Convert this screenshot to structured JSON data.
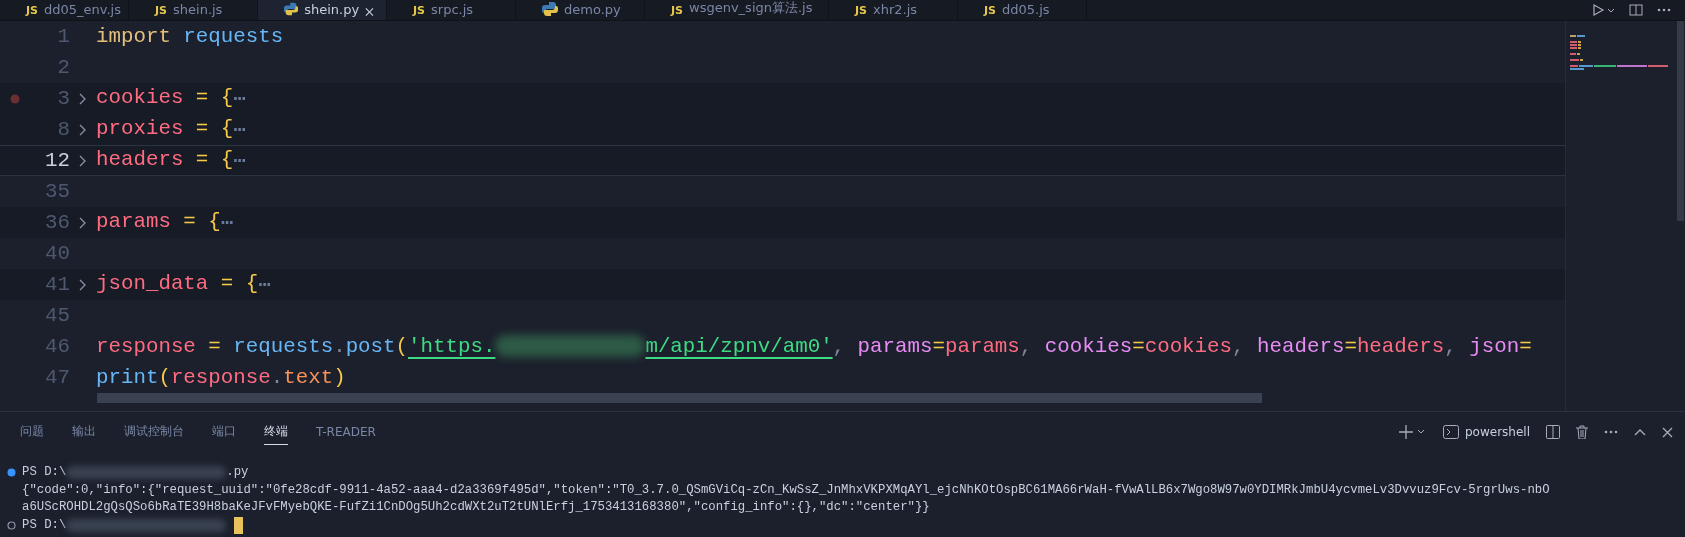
{
  "editor_tabs": [
    {
      "label": "dd05_env.js",
      "badge": "JS",
      "kind": "js",
      "selected": false
    },
    {
      "label": "shein.js",
      "badge": "JS",
      "kind": "js",
      "selected": false
    },
    {
      "label": "shein.py",
      "kind": "py",
      "selected": true
    },
    {
      "label": "srpc.js",
      "badge": "JS",
      "kind": "js",
      "selected": false
    },
    {
      "label": "demo.py",
      "kind": "py",
      "selected": false
    },
    {
      "label": "wsgenv_sign算法.js",
      "badge": "JS",
      "kind": "js",
      "selected": false
    },
    {
      "label": "xhr2.js",
      "badge": "JS",
      "kind": "js",
      "selected": false
    },
    {
      "label": "dd05.js",
      "badge": "JS",
      "kind": "js",
      "selected": false
    }
  ],
  "code_lines": [
    {
      "number": "1",
      "folded": false,
      "breakpoint": false,
      "current": false,
      "tokens": [
        {
          "text": "import",
          "kind": "keyword"
        },
        {
          "text": " requests",
          "kind": "module"
        }
      ]
    },
    {
      "number": "2",
      "folded": false,
      "breakpoint": false,
      "current": false
    },
    {
      "number": "3",
      "folded": true,
      "breakpoint": true,
      "current": false,
      "tokens": [
        {
          "text": "cookies",
          "kind": "var"
        },
        {
          "text": " = ",
          "kind": "op"
        },
        {
          "text": "{",
          "kind": "brace"
        },
        {
          "text": "⋯",
          "kind": "fold"
        }
      ]
    },
    {
      "number": "8",
      "folded": true,
      "breakpoint": false,
      "current": false,
      "tokens": [
        {
          "text": "proxies",
          "kind": "var"
        },
        {
          "text": " = ",
          "kind": "op"
        },
        {
          "text": "{",
          "kind": "brace"
        },
        {
          "text": "⋯",
          "kind": "fold"
        }
      ]
    },
    {
      "number": "12",
      "folded": true,
      "breakpoint": false,
      "current": true,
      "tokens": [
        {
          "text": "headers",
          "kind": "var"
        },
        {
          "text": " = ",
          "kind": "op"
        },
        {
          "text": "{",
          "kind": "brace"
        },
        {
          "text": "⋯",
          "kind": "fold"
        }
      ]
    },
    {
      "number": "35",
      "folded": false,
      "breakpoint": false,
      "current": false
    },
    {
      "number": "36",
      "folded": true,
      "breakpoint": false,
      "current": false,
      "tokens": [
        {
          "text": "params",
          "kind": "var"
        },
        {
          "text": " = ",
          "kind": "op"
        },
        {
          "text": "{",
          "kind": "brace"
        },
        {
          "text": "⋯",
          "kind": "fold"
        }
      ]
    },
    {
      "number": "40",
      "folded": false,
      "breakpoint": false,
      "current": false
    },
    {
      "number": "41",
      "folded": true,
      "breakpoint": false,
      "current": false,
      "tokens": [
        {
          "text": "json_data",
          "kind": "var"
        },
        {
          "text": " = ",
          "kind": "op"
        },
        {
          "text": "{",
          "kind": "brace"
        },
        {
          "text": "⋯",
          "kind": "fold"
        }
      ]
    },
    {
      "number": "45",
      "folded": false,
      "breakpoint": false,
      "current": false
    },
    {
      "number": "46",
      "folded": false,
      "breakpoint": false,
      "current": false,
      "tokens": [
        {
          "text": "response",
          "kind": "var"
        },
        {
          "text": " = ",
          "kind": "op"
        },
        {
          "text": "requests",
          "kind": "module"
        },
        {
          "text": ".",
          "kind": "punct"
        },
        {
          "text": "post",
          "kind": "func"
        },
        {
          "text": "(",
          "kind": "brace"
        },
        {
          "text": "'https.",
          "kind": "string"
        },
        {
          "kind": "blur"
        },
        {
          "text": "m/api/zpnv/am0'",
          "kind": "string"
        },
        {
          "text": ", ",
          "kind": "punct"
        },
        {
          "text": "params",
          "kind": "param"
        },
        {
          "text": "=",
          "kind": "op"
        },
        {
          "text": "params",
          "kind": "var"
        },
        {
          "text": ", ",
          "kind": "punct"
        },
        {
          "text": "cookies",
          "kind": "param"
        },
        {
          "text": "=",
          "kind": "op"
        },
        {
          "text": "cookies",
          "kind": "var"
        },
        {
          "text": ", ",
          "kind": "punct"
        },
        {
          "text": "headers",
          "kind": "param"
        },
        {
          "text": "=",
          "kind": "op"
        },
        {
          "text": "headers",
          "kind": "var"
        },
        {
          "text": ", ",
          "kind": "punct"
        },
        {
          "text": "json",
          "kind": "param"
        },
        {
          "text": "=",
          "kind": "op"
        }
      ]
    },
    {
      "number": "47",
      "folded": false,
      "breakpoint": false,
      "current": false,
      "tokens": [
        {
          "text": "print",
          "kind": "func"
        },
        {
          "text": "(",
          "kind": "brace"
        },
        {
          "text": "response",
          "kind": "var"
        },
        {
          "text": ".",
          "kind": "punct"
        },
        {
          "text": "text",
          "kind": "attr"
        },
        {
          "text": ")",
          "kind": "brace"
        }
      ]
    }
  ],
  "panel_tabs": [
    {
      "label": "问题",
      "selected": false
    },
    {
      "label": "输出",
      "selected": false
    },
    {
      "label": "调试控制台",
      "selected": false
    },
    {
      "label": "端口",
      "selected": false
    },
    {
      "label": "终端",
      "selected": true
    },
    {
      "label": "T-READER",
      "selected": false
    }
  ],
  "terminal_shell": "powershell",
  "terminal_lines": [
    {
      "kind": "prompt",
      "succeeded": true,
      "prompt": "PS D:\\",
      "tail": ".py"
    },
    {
      "kind": "output",
      "text": "{\"code\":0,\"info\":{\"request_uuid\":\"0fe28cdf-9911-4a52-aaa4-d2a3369f495d\",\"token\":\"T0_3.7.0_QSmGViCq-zCn_KwSsZ_JnMhxVKPXMqAYl_ejcNhKOtOspBC61MA66rWaH-fVwAlLB6x7Wgo8W97w0YDIMRkJmbU4ycvmeLv3Dvvuz9Fcv-5rgrUws-nbO"
    },
    {
      "kind": "output",
      "text": "a6UScROHDL2gQsQSo6bRaTE39H8baKeJFvFMyebQKE-FufZi1CnDOg5Uh2cdWXt2uT2tUNlErfj_1753413168380\",\"config_info\":{},\"dc\":\"center\"}}"
    },
    {
      "kind": "prompt",
      "succeeded": false,
      "prompt": "PS D:\\",
      "cursor": true
    }
  ]
}
